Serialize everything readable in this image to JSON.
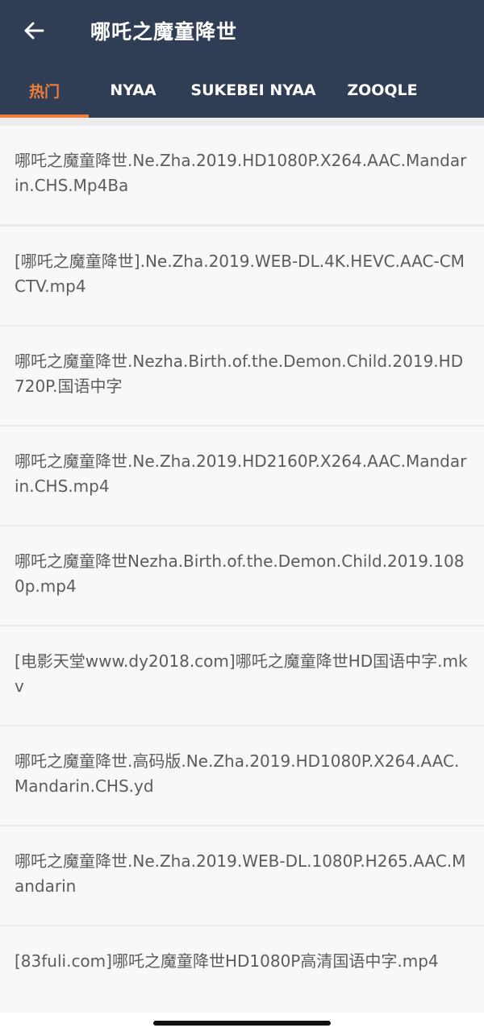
{
  "toolbar": {
    "back_icon": "arrow-left-icon",
    "title": "哪吒之魔童降世"
  },
  "tabs": [
    {
      "label": "热门",
      "active": true
    },
    {
      "label": "NYAA",
      "active": false
    },
    {
      "label": "SUKEBEI NYAA",
      "active": false
    },
    {
      "label": "ZOOQLE",
      "active": false
    }
  ],
  "colors": {
    "header_bg": "#2f3d55",
    "accent": "#ef7d3b",
    "item_bg": "#f8f8f8",
    "item_text": "#5c5c5c"
  },
  "results": [
    "哪吒之魔童降世.Ne.Zha.2019.HD1080P.X264.AAC.Mandarin.CHS.Mp4Ba",
    "[哪吒之魔童降世].Ne.Zha.2019.WEB-DL.4K.HEVC.AAC-CMCTV.mp4",
    "哪吒之魔童降世.Nezha.Birth.of.the.Demon.Child.2019.HD720P.国语中字",
    "哪吒之魔童降世.Ne.Zha.2019.HD2160P.X264.AAC.Mandarin.CHS.mp4",
    "哪吒之魔童降世Nezha.Birth.of.the.Demon.Child.2019.1080p.mp4",
    "[电影天堂www.dy2018.com]哪吒之魔童降世HD国语中字.mkv",
    "哪吒之魔童降世.高码版.Ne.Zha.2019.HD1080P.X264.AAC.Mandarin.CHS.yd",
    "哪吒之魔童降世.Ne.Zha.2019.WEB-DL.1080P.H265.AAC.Mandarin",
    "[83fuli.com]哪吒之魔童降世HD1080P高清国语中字.mp4"
  ]
}
